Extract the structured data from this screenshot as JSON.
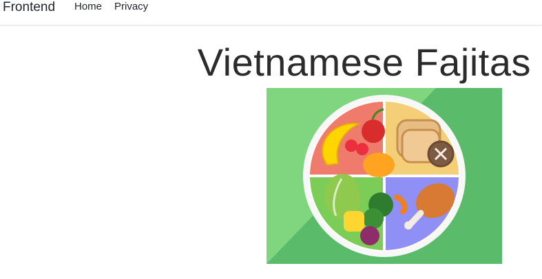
{
  "navbar": {
    "brand": "Frontend",
    "links": [
      "Home",
      "Privacy"
    ]
  },
  "page": {
    "title": "Vietnamese Fajitas"
  },
  "colors": {
    "background_green": "#7fd67f",
    "diagonal_green": "#5abb6b",
    "plate_rim": "#ffffff",
    "fruit_quadrant": "#ee7b6b",
    "grain_quadrant": "#f4cf77",
    "veg_quadrant": "#7ccc58",
    "protein_quadrant": "#8f8ff6"
  },
  "icons": {
    "hero": "food-plate-icon"
  }
}
